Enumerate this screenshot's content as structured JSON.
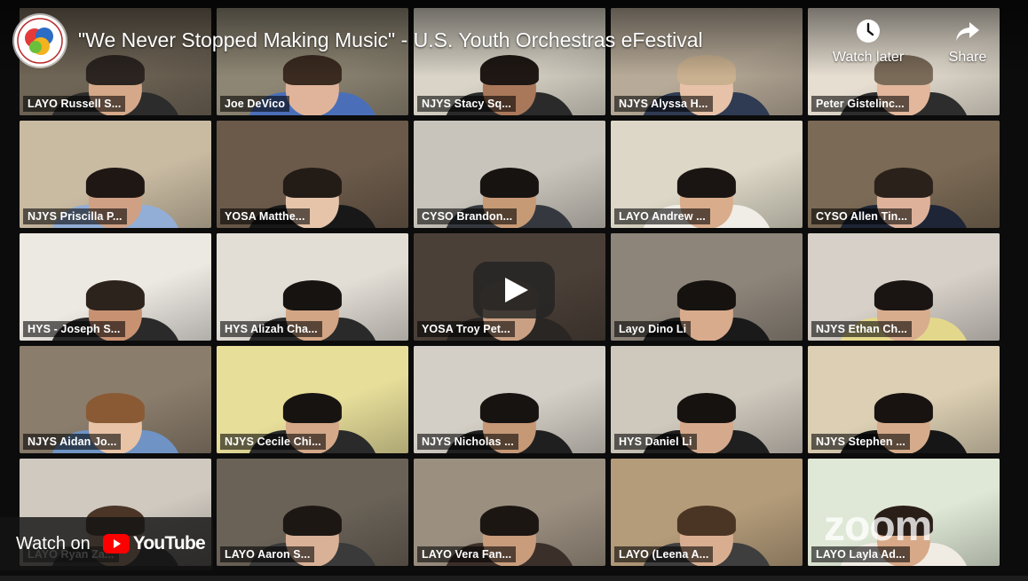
{
  "video": {
    "title": "\"We Never Stopped Making Music\" - U.S. Youth Orchestras eFestival",
    "watch_later_label": "Watch later",
    "share_label": "Share",
    "watch_on_label": "Watch on",
    "youtube_label": "YouTube"
  },
  "zoom_watermark": "zoom",
  "participants": [
    {
      "name": "LAYO Russell S...",
      "bg": "#6f6556",
      "skin": "#d4a888",
      "hair": "#2b2420",
      "shirt": "#2c2c2c",
      "active": true
    },
    {
      "name": "Joe DeVico",
      "bg": "#8e8674",
      "skin": "#e0b49a",
      "hair": "#3a2a20",
      "shirt": "#4a6fb8"
    },
    {
      "name": "NJYS Stacy Sq...",
      "bg": "#d9d4c7",
      "skin": "#a9785a",
      "hair": "#1e1714",
      "shirt": "#2a2a2a"
    },
    {
      "name": "NJYS Alyssa H...",
      "bg": "#b7aa98",
      "skin": "#e7c2a8",
      "hair": "#c9b08f",
      "shirt": "#2f3b52"
    },
    {
      "name": "Peter Gistelinc...",
      "bg": "#e6ded1",
      "skin": "#e2b79c",
      "hair": "#7a6a58",
      "shirt": "#2d2d2d"
    },
    {
      "name": "NJYS Priscilla P...",
      "bg": "#c9bba2",
      "skin": "#cfa084",
      "hair": "#1e1714",
      "shirt": "#93aed6"
    },
    {
      "name": "YOSA Matthe...",
      "bg": "#6b5a4a",
      "skin": "#e6c4aa",
      "hair": "#231b16",
      "shirt": "#181818"
    },
    {
      "name": "CYSO Brandon...",
      "bg": "#c9c4bb",
      "skin": "#c79a76",
      "hair": "#171311",
      "shirt": "#35393f"
    },
    {
      "name": "LAYO Andrew ...",
      "bg": "#dcd7c6",
      "skin": "#d9ad8c",
      "hair": "#1a1512",
      "shirt": "#f0ede6"
    },
    {
      "name": "CYSO Allen Tin...",
      "bg": "#7b6a55",
      "skin": "#deb29a",
      "hair": "#2a211b",
      "shirt": "#1e2536"
    },
    {
      "name": "HYS - Joseph S...",
      "bg": "#ece8e2",
      "skin": "#c89272",
      "hair": "#2c231c",
      "shirt": "#2a2a2a"
    },
    {
      "name": "HYS Alizah Cha...",
      "bg": "#e2ddd5",
      "skin": "#d2a585",
      "hair": "#171311",
      "shirt": "#2a2a2a"
    },
    {
      "name": "YOSA Troy Pet...",
      "bg": "#4b4038",
      "skin": "#caa084",
      "hair": "#5a4636",
      "shirt": "#2a2624"
    },
    {
      "name": "Layo Dino Li",
      "bg": "#8e857a",
      "skin": "#d8ab8c",
      "hair": "#161210",
      "shirt": "#1a1a1a"
    },
    {
      "name": "NJYS Ethan Ch...",
      "bg": "#d6d0c8",
      "skin": "#d8ad8e",
      "hair": "#1a1512",
      "shirt": "#e3d78c"
    },
    {
      "name": "NJYS Aidan Jo...",
      "bg": "#8b7d6c",
      "skin": "#e8c3a6",
      "hair": "#8a5a34",
      "shirt": "#6f93c4"
    },
    {
      "name": "NJYS Cecile Chi...",
      "bg": "#e7de9a",
      "skin": "#d4a888",
      "hair": "#171311",
      "shirt": "#2a2a2a"
    },
    {
      "name": "NJYS Nicholas ...",
      "bg": "#d4cfc6",
      "skin": "#c59876",
      "hair": "#171311",
      "shirt": "#1f1f1f"
    },
    {
      "name": "HYS Daniel Li",
      "bg": "#cfc8bd",
      "skin": "#d5a98b",
      "hair": "#161210",
      "shirt": "#1f1f1f"
    },
    {
      "name": "NJYS Stephen ...",
      "bg": "#dccfb3",
      "skin": "#d6ab8b",
      "hair": "#181311",
      "shirt": "#161616"
    },
    {
      "name": "LAYO Ryan Za...",
      "bg": "#cfc9c0",
      "skin": "#d8aa88",
      "hair": "#4a3526",
      "shirt": "#2c2c2c"
    },
    {
      "name": "LAYO Aaron S...",
      "bg": "#6a6257",
      "skin": "#d9b196",
      "hair": "#1d1714",
      "shirt": "#3a3a3a"
    },
    {
      "name": "LAYO Vera Fan...",
      "bg": "#9b8f80",
      "skin": "#c99c7c",
      "hair": "#1c1613",
      "shirt": "#3b2f2a"
    },
    {
      "name": "LAYO (Leena A...",
      "bg": "#b49c7a",
      "skin": "#d9ae90",
      "hair": "#4a3424",
      "shirt": "#3e3e3e"
    },
    {
      "name": "LAYO Layla Ad...",
      "bg": "#dfe8d6",
      "skin": "#d7a988",
      "hair": "#2a1e18",
      "shirt": "#f0ece4"
    }
  ],
  "colors": {
    "active_speaker_border": "#6fbf3a",
    "youtube_red": "#ff0000"
  }
}
